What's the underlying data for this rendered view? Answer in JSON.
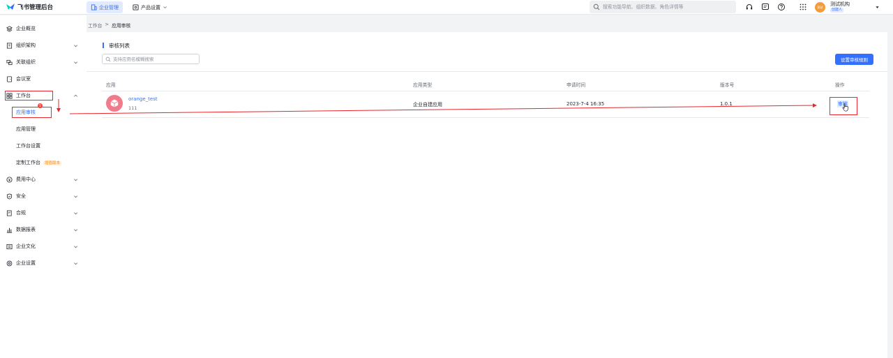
{
  "brand": {
    "name": "飞书管理后台"
  },
  "topnav": [
    {
      "label": "企业管理",
      "icon": "building-icon",
      "active": true
    },
    {
      "label": "产品设置",
      "icon": "grid-settings-icon",
      "active": false
    }
  ],
  "search": {
    "placeholder": "搜索功能导航、组织数据、角色详情等"
  },
  "toolbar_icons": [
    "headset-icon",
    "message-icon",
    "help-icon",
    "apps-grid-icon"
  ],
  "user": {
    "avatar_text": "测试",
    "org_name": "测试机构",
    "role_badge": "创建人"
  },
  "sidebar": {
    "items": [
      {
        "label": "企业概览",
        "icon": "overview-icon",
        "chevron": false
      },
      {
        "label": "组织架构",
        "icon": "org-icon",
        "chevron": true
      },
      {
        "label": "关联组织",
        "icon": "link-org-icon",
        "chevron": true
      },
      {
        "label": "会议室",
        "icon": "meeting-room-icon",
        "chevron": false
      },
      {
        "label": "工作台",
        "icon": "workbench-icon",
        "chevron": true,
        "expanded": true
      },
      {
        "label": "费用中心",
        "icon": "fee-icon",
        "chevron": true
      },
      {
        "label": "安全",
        "icon": "shield-icon",
        "chevron": true
      },
      {
        "label": "合规",
        "icon": "compliance-icon",
        "chevron": true
      },
      {
        "label": "数据报表",
        "icon": "chart-icon",
        "chevron": true
      },
      {
        "label": "企业文化",
        "icon": "culture-icon",
        "chevron": true
      },
      {
        "label": "企业设置",
        "icon": "settings-icon",
        "chevron": true
      }
    ],
    "workbench_sub": [
      {
        "label": "应用审核",
        "active": true,
        "badge": "1"
      },
      {
        "label": "应用管理"
      },
      {
        "label": "工作台设置"
      },
      {
        "label": "定制工作台",
        "tag": "增值版本"
      }
    ]
  },
  "breadcrumb": {
    "parent": "工作台",
    "separator": ">",
    "current": "应用审核"
  },
  "review_list": {
    "title": "审核列表",
    "search_placeholder": "支持应用名模糊搜索",
    "rules_button": "设置审核规则",
    "columns": [
      "应用",
      "应用类型",
      "申请时间",
      "版本号",
      "操作"
    ],
    "rows": [
      {
        "app_name": "orange_test",
        "app_desc": "111",
        "app_type": "企业自建应用",
        "apply_time": "2023-7-4 16:35",
        "version": "1.0.1",
        "action": "审核"
      }
    ]
  },
  "colors": {
    "accent": "#3370ff",
    "annotation": "#e8262d",
    "app_icon_bg": "#f17b8b"
  }
}
